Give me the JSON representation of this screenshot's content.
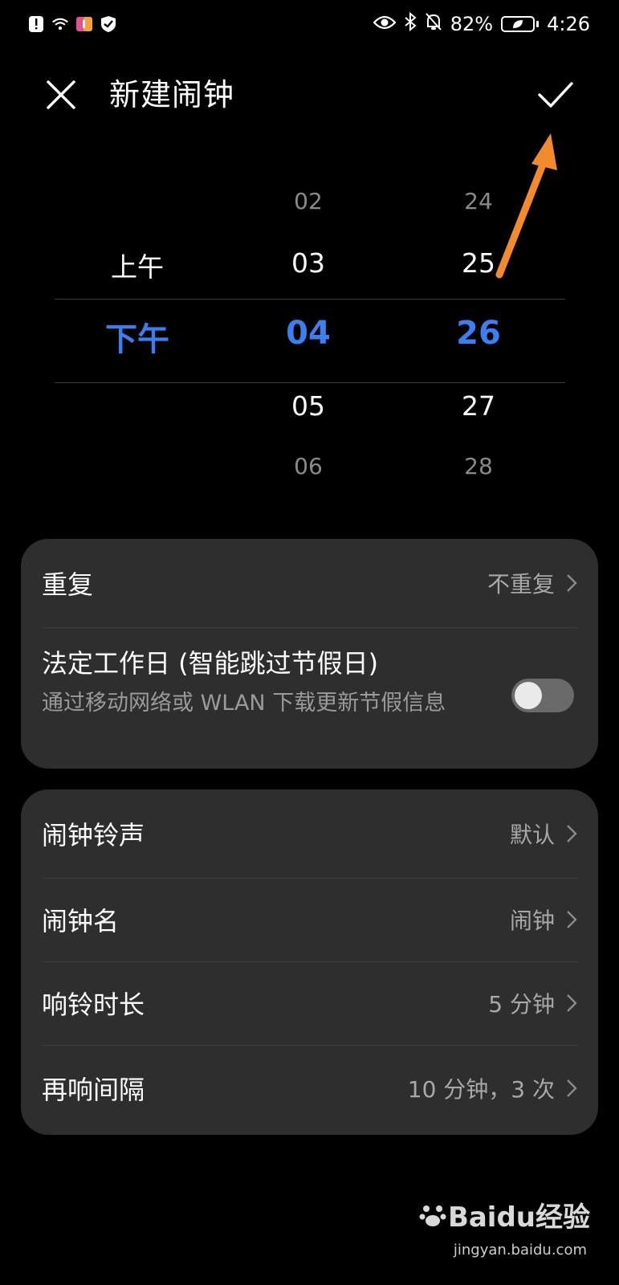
{
  "status_bar": {
    "battery_percent": "82%",
    "time": "4:26",
    "icons_left": [
      "alert-icon",
      "wifi-icon",
      "app-badge-icon",
      "shield-icon"
    ],
    "icons_right": [
      "eye-icon",
      "bluetooth-icon",
      "mute-bell-icon",
      "battery-icon"
    ]
  },
  "header": {
    "title": "新建闹钟",
    "close_icon": "close-icon",
    "confirm_icon": "check-icon"
  },
  "picker": {
    "period": {
      "above": "上午",
      "selected": "下午"
    },
    "hour": {
      "far_above": "02",
      "above": "03",
      "selected": "04",
      "below": "05",
      "far_below": "06"
    },
    "minute": {
      "far_above": "24",
      "above": "25",
      "selected": "26",
      "below": "27",
      "far_below": "28"
    },
    "selected_color": "#3c7ff0"
  },
  "annotation": {
    "arrow_color": "#f48a2e",
    "points_to": "check-icon"
  },
  "settings_card_1": {
    "repeat": {
      "label": "重复",
      "value": "不重复"
    },
    "workday": {
      "label": "法定工作日 (智能跳过节假日)",
      "description": "通过移动网络或 WLAN 下载更新节假信息",
      "enabled": false
    }
  },
  "settings_card_2": {
    "ringtone": {
      "label": "闹钟铃声",
      "value": "默认"
    },
    "name": {
      "label": "闹钟名",
      "value": "闹钟"
    },
    "duration": {
      "label": "响铃时长",
      "value": "5 分钟"
    },
    "snooze": {
      "label": "再响间隔",
      "value": "10 分钟，3 次"
    }
  },
  "watermark": {
    "brand": "Baidu经验",
    "url": "jingyan.baidu.com"
  }
}
